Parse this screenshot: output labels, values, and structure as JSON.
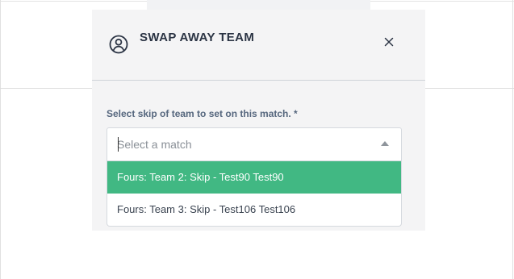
{
  "modal": {
    "title": "SWAP AWAY TEAM",
    "icon": "user-circle-icon",
    "close_icon": "close-icon"
  },
  "field": {
    "label": "Select skip of team to set on this match. *",
    "placeholder": "Select a match",
    "value": ""
  },
  "dropdown": {
    "options": [
      {
        "label": "Fours: Team 2: Skip - Test90 Test90",
        "highlighted": true
      },
      {
        "label": "Fours: Team 3: Skip - Test106 Test106",
        "highlighted": false
      }
    ]
  },
  "colors": {
    "highlight": "#41b883",
    "modal_bg": "#f4f4f5",
    "label": "#56677e",
    "title": "#2b3444"
  }
}
